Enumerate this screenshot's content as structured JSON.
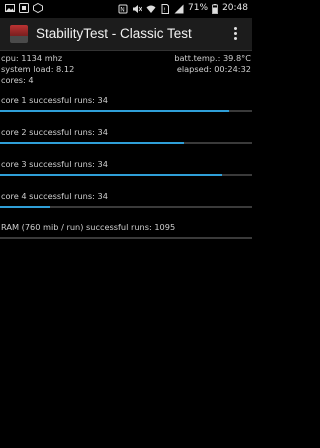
{
  "status_bar": {
    "battery": "71%",
    "time": "20:48"
  },
  "app_bar": {
    "title": "StabilityTest - Classic Test"
  },
  "info": {
    "cpu": "cpu: 1134 mhz",
    "batt_temp": "batt.temp.: 39.8°C",
    "system_load": "system load: 8.12",
    "elapsed": "elapsed: 00:24:32",
    "cores": "cores: 4"
  },
  "cores": [
    {
      "label": "core 1 successful runs: 34",
      "progress": 0.91
    },
    {
      "label": "core 2 successful runs: 34",
      "progress": 0.73
    },
    {
      "label": "core 3 successful runs: 34",
      "progress": 0.88
    },
    {
      "label": "core 4 successful runs: 34",
      "progress": 0.2
    }
  ],
  "ram": {
    "label": "RAM (760 mib / run) successful runs: 1095"
  },
  "colors": {
    "accent": "#2f9fd8",
    "background": "#000000",
    "appbar": "#1c1c1c"
  }
}
